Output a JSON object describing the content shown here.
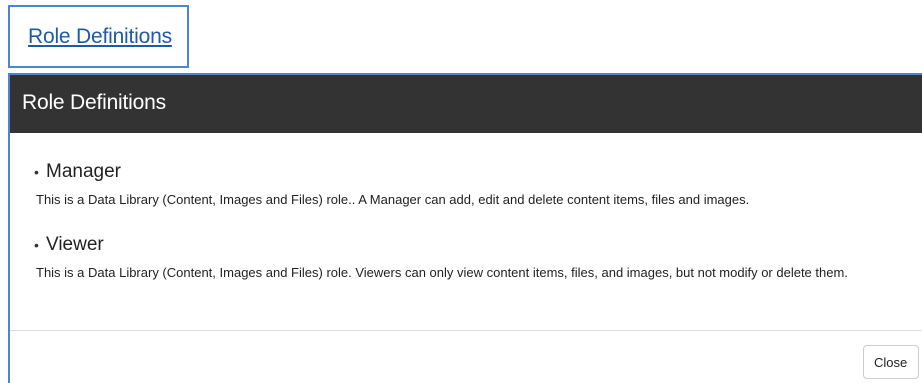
{
  "top_link": {
    "label": "Role Definitions"
  },
  "modal": {
    "title": "Role Definitions",
    "roles": [
      {
        "bullet": "•",
        "name": "Manager",
        "description": "This is a Data Library (Content, Images and Files) role.. A Manager can add, edit and delete content items, files and images."
      },
      {
        "bullet": "•",
        "name": "Viewer",
        "description": "This is a Data Library (Content, Images and Files) role. Viewers can only view content items, files, and images, but not modify or delete them."
      }
    ],
    "close_label": "Close"
  },
  "colors": {
    "header_background": "#333333",
    "link": "#1f5aa6",
    "highlight_border": "#4a86d4"
  }
}
